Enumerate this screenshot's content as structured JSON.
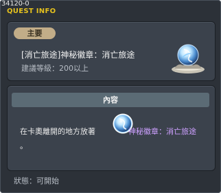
{
  "window": {
    "quest_id": "34120-0",
    "title": "QUEST INFO"
  },
  "summary": {
    "tag": "主要",
    "quest_name": "[消亡旅途]神秘徽章：消亡旅途",
    "level_requirement": "建議等級：200以上",
    "reward_icon": "mystic-badge-icon"
  },
  "content": {
    "header": "內容",
    "description_text": "在卡奧離開的地方放著",
    "item_icon": "mystic-badge-icon",
    "item_name": "神秘徽章：消亡旅途",
    "description_end": "。"
  },
  "footer": {
    "status": "狀態：可開始"
  },
  "colors": {
    "title": "#e6c21d",
    "item_name": "#cda0ff",
    "tag_bg": "#c2ad88",
    "panel_bg": "#3b424c",
    "window_bg": "#2c3138"
  }
}
